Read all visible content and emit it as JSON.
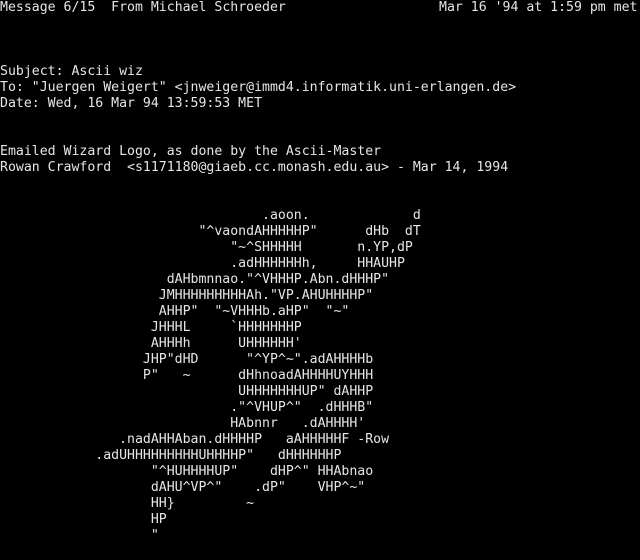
{
  "status_bar": {
    "message_position": "Message 6/15",
    "from": "From Michael Schroeder",
    "date": "Mar 16 '94 at 1:59 pm met"
  },
  "headers": {
    "subject": "Subject: Ascii wiz",
    "to": "To: \"Juergen Weigert\" <jnweiger@immd4.informatik.uni-erlangen.de>",
    "date": "Date: Wed, 16 Mar 94 13:59:53 MET"
  },
  "body": {
    "line1": "Emailed Wizard Logo, as done by the Ascii-Master",
    "line2": "Rowan Crawford  <s1171180@giaeb.cc.monash.edu.au> - Mar 14, 1994"
  },
  "ascii_art": "                                 .aoon.             d\n                         \"^vaondAHHHHHP\"      dHb  dT\n                             \"~^SHHHHH       n.YP,dP\n                             .adHHHHHHh,     HHAUHP\n                     dAHbmnnao.\"^VHHHP.Abn.dHHHP\"\n                    JMHHHHHHHHHAh.\"VP.AHUHHHHP\"\n                    AHHP\"  \"~VHHHb.aHP\"  \"~\"\n                   JHHHL     `HHHHHHHP\n                   AHHHh      UHHHHHH'\n                  JHP\"dHD      \"^YP^~\".adAHHHHb\n                  P\"   ~      dHhnoadAHHHHUYHHH\n                              UHHHHHHHUP\" dAHHP\n                             .\"^VHUP^\"  .dHHHB\"\n                             HAbnnr   .dAHHHH'\n               .nadAHHAban.dHHHHP   aAHHHHHF -Row\n            .adUHHHHHHHHHUHHHHP\"   dHHHHHHP\n                   \"^HUHHHHUP\"    dHP^\" HHAbnao\n                   dAHU^VP^\"    .dP\"    VHP^~\"\n                   HH}         ~\n                   HP\n                   \""
}
